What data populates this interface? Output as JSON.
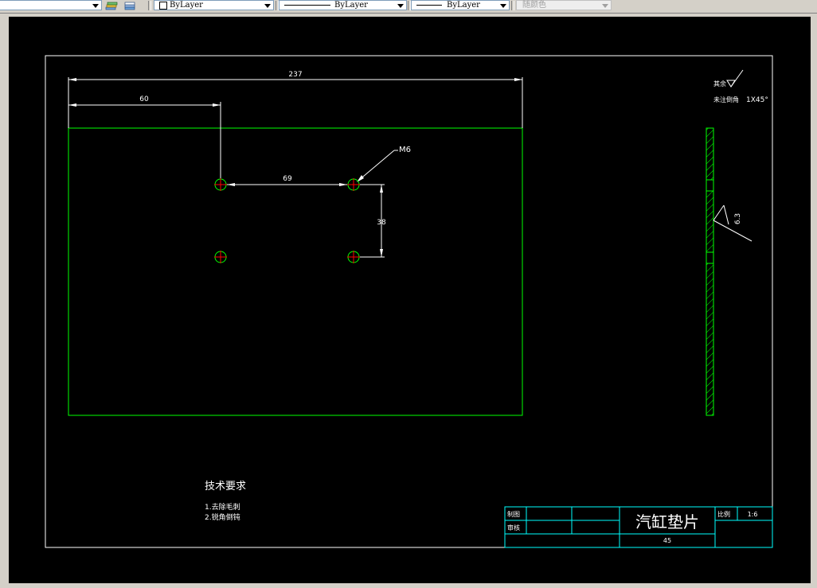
{
  "toolbar": {
    "color": "ByLayer",
    "linetype": "ByLayer",
    "lineweight": "ByLayer",
    "plotstyle": "随颜色",
    "icons": [
      "layer-states-icon",
      "layer-previous-icon"
    ]
  },
  "drawing": {
    "dim_total": "237",
    "dim_left": "60",
    "dim_hole_spacing_h": "69",
    "dim_hole_spacing_v": "38",
    "thread_label": "M6",
    "roughness_value": "6.3",
    "corner_note_prefix": "其余",
    "chamfer_note_prefix": "未注倒角",
    "chamfer_value": "1X45°",
    "tech_title": "技术要求",
    "tech_items": [
      "1.去除毛刺",
      "2.锐角倒钝"
    ]
  },
  "title_block": {
    "drawn_by": "制图",
    "checked_by": "审核",
    "part_name": "汽缸垫片",
    "scale_label": "比例",
    "scale_value": "1:6",
    "material": "45"
  },
  "colors": {
    "outline": "#00ff00",
    "dimension": "#ffffff",
    "title_block": "#00ffff",
    "center_mark": "#ff0000",
    "hatch": "#00ff00"
  }
}
